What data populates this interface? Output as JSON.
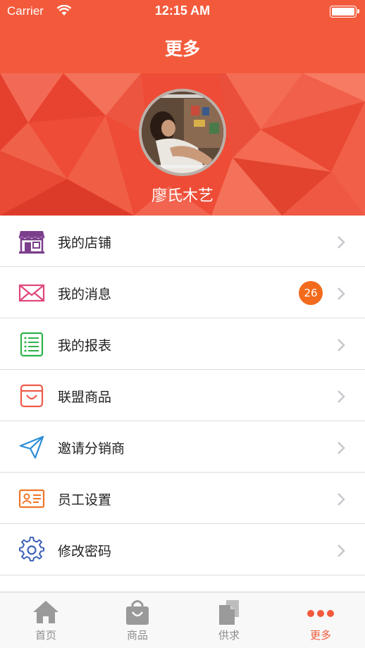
{
  "status_bar": {
    "carrier": "Carrier",
    "time": "12:15 AM"
  },
  "nav": {
    "title": "更多"
  },
  "profile": {
    "name": "廖氏木艺"
  },
  "menu": [
    {
      "label": "我的店铺",
      "icon": "store-icon",
      "color": "#7b3f8c"
    },
    {
      "label": "我的消息",
      "icon": "envelope-icon",
      "color": "#e0457b",
      "badge": "26"
    },
    {
      "label": "我的报表",
      "icon": "report-list-icon",
      "color": "#2eb34a"
    },
    {
      "label": "联盟商品",
      "icon": "shopping-box-icon",
      "color": "#ef5a4a"
    },
    {
      "label": "邀请分销商",
      "icon": "paper-plane-icon",
      "color": "#2a8fd8"
    },
    {
      "label": "员工设置",
      "icon": "id-card-icon",
      "color": "#f0762a"
    },
    {
      "label": "修改密码",
      "icon": "gear-icon",
      "color": "#3b5fb8"
    }
  ],
  "tabs": [
    {
      "label": "首页",
      "icon": "home-icon"
    },
    {
      "label": "商品",
      "icon": "shopping-bag-icon"
    },
    {
      "label": "供求",
      "icon": "documents-icon"
    },
    {
      "label": "更多",
      "icon": "more-dots-icon",
      "active": true
    }
  ],
  "colors": {
    "brand": "#f35a3c",
    "badge": "#f26b1d",
    "tab_inactive": "#8e8e8e"
  }
}
